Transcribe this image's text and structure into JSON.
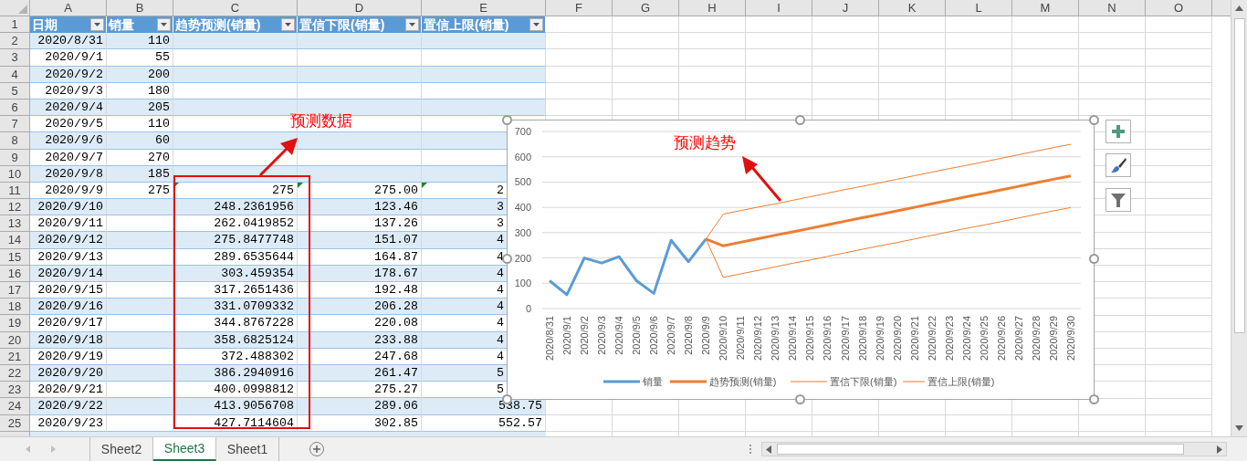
{
  "columns": [
    "A",
    "B",
    "C",
    "D",
    "E",
    "F",
    "G",
    "H",
    "I",
    "J",
    "K",
    "L",
    "M",
    "N",
    "O"
  ],
  "table": {
    "header": {
      "row_number": "1",
      "cells": [
        "日期",
        "销量",
        "趋势预测(销量)",
        "置信下限(销量)",
        "置信上限(销量)"
      ]
    },
    "rows": [
      {
        "row_number": "2",
        "date": "2020/8/31",
        "sales": "110"
      },
      {
        "row_number": "3",
        "date": "2020/9/1",
        "sales": "55"
      },
      {
        "row_number": "4",
        "date": "2020/9/2",
        "sales": "200"
      },
      {
        "row_number": "5",
        "date": "2020/9/3",
        "sales": "180"
      },
      {
        "row_number": "6",
        "date": "2020/9/4",
        "sales": "205"
      },
      {
        "row_number": "7",
        "date": "2020/9/5",
        "sales": "110"
      },
      {
        "row_number": "8",
        "date": "2020/9/6",
        "sales": "60"
      },
      {
        "row_number": "9",
        "date": "2020/9/7",
        "sales": "270"
      },
      {
        "row_number": "10",
        "date": "2020/9/8",
        "sales": "185"
      },
      {
        "row_number": "11",
        "date": "2020/9/9",
        "sales": "275",
        "trend": "275",
        "lower": "275.00",
        "upper": "2",
        "upper_cut": true,
        "flagged": true
      },
      {
        "row_number": "12",
        "date": "2020/9/10",
        "trend": "248.2361956",
        "lower": "123.46",
        "upper": "3",
        "upper_cut": true
      },
      {
        "row_number": "13",
        "date": "2020/9/11",
        "trend": "262.0419852",
        "lower": "137.26",
        "upper": "3",
        "upper_cut": true
      },
      {
        "row_number": "14",
        "date": "2020/9/12",
        "trend": "275.8477748",
        "lower": "151.07",
        "upper": "4",
        "upper_cut": true
      },
      {
        "row_number": "15",
        "date": "2020/9/13",
        "trend": "289.6535644",
        "lower": "164.87",
        "upper": "4",
        "upper_cut": true
      },
      {
        "row_number": "16",
        "date": "2020/9/14",
        "trend": "303.459354",
        "lower": "178.67",
        "upper": "4",
        "upper_cut": true
      },
      {
        "row_number": "17",
        "date": "2020/9/15",
        "trend": "317.2651436",
        "lower": "192.48",
        "upper": "4",
        "upper_cut": true
      },
      {
        "row_number": "18",
        "date": "2020/9/16",
        "trend": "331.0709332",
        "lower": "206.28",
        "upper": "4",
        "upper_cut": true
      },
      {
        "row_number": "19",
        "date": "2020/9/17",
        "trend": "344.8767228",
        "lower": "220.08",
        "upper": "4",
        "upper_cut": true
      },
      {
        "row_number": "20",
        "date": "2020/9/18",
        "trend": "358.6825124",
        "lower": "233.88",
        "upper": "4",
        "upper_cut": true
      },
      {
        "row_number": "21",
        "date": "2020/9/19",
        "trend": "372.488302",
        "lower": "247.68",
        "upper": "4",
        "upper_cut": true
      },
      {
        "row_number": "22",
        "date": "2020/9/20",
        "trend": "386.2940916",
        "lower": "261.47",
        "upper": "5",
        "upper_cut": true
      },
      {
        "row_number": "23",
        "date": "2020/9/21",
        "trend": "400.0998812",
        "lower": "275.27",
        "upper": "5",
        "upper_cut": true
      },
      {
        "row_number": "24",
        "date": "2020/9/22",
        "trend": "413.9056708",
        "lower": "289.06",
        "upper": "538.75",
        "upper_cut": false
      },
      {
        "row_number": "25",
        "date": "2020/9/23",
        "trend": "427.7114604",
        "lower": "302.85",
        "upper": "552.57",
        "upper_cut": false
      }
    ]
  },
  "callouts": [
    {
      "text": "预测数据"
    },
    {
      "text": "预测趋势"
    }
  ],
  "chart": {
    "chart_data": {
      "type": "line",
      "categories": [
        "2020/8/31",
        "2020/9/1",
        "2020/9/2",
        "2020/9/3",
        "2020/9/4",
        "2020/9/5",
        "2020/9/6",
        "2020/9/7",
        "2020/9/8",
        "2020/9/9",
        "2020/9/10",
        "2020/9/11",
        "2020/9/12",
        "2020/9/13",
        "2020/9/14",
        "2020/9/15",
        "2020/9/16",
        "2020/9/17",
        "2020/9/18",
        "2020/9/19",
        "2020/9/20",
        "2020/9/21",
        "2020/9/22",
        "2020/9/23",
        "2020/9/24",
        "2020/9/25",
        "2020/9/26",
        "2020/9/27",
        "2020/9/28",
        "2020/9/29",
        "2020/9/30"
      ],
      "series": [
        {
          "name": "销量",
          "color": "#5b9bd5",
          "values": [
            110,
            55,
            200,
            180,
            205,
            110,
            60,
            270,
            185,
            275,
            null,
            null,
            null,
            null,
            null,
            null,
            null,
            null,
            null,
            null,
            null,
            null,
            null,
            null,
            null,
            null,
            null,
            null,
            null,
            null,
            null
          ]
        },
        {
          "name": "趋势预测(销量)",
          "color": "#ed7d31",
          "values": [
            null,
            null,
            null,
            null,
            null,
            null,
            null,
            null,
            null,
            275,
            248,
            262,
            276,
            290,
            303,
            317,
            331,
            345,
            359,
            372,
            386,
            400,
            414,
            428,
            442,
            455,
            469,
            483,
            497,
            511,
            524
          ]
        },
        {
          "name": "置信下限(销量)",
          "color": "#ed7d31",
          "values": [
            null,
            null,
            null,
            null,
            null,
            null,
            null,
            null,
            null,
            275,
            123,
            137,
            151,
            165,
            179,
            192,
            206,
            220,
            234,
            248,
            261,
            275,
            289,
            303,
            317,
            330,
            344,
            358,
            372,
            386,
            399
          ]
        },
        {
          "name": "置信上限(销量)",
          "color": "#ed7d31",
          "values": [
            null,
            null,
            null,
            null,
            null,
            null,
            null,
            null,
            null,
            275,
            373,
            387,
            401,
            414,
            428,
            442,
            456,
            470,
            483,
            497,
            511,
            525,
            539,
            553,
            566,
            580,
            594,
            608,
            622,
            636,
            649
          ]
        }
      ],
      "ylim": [
        0,
        700
      ],
      "yticks": [
        0,
        100,
        200,
        300,
        400,
        500,
        600,
        700
      ],
      "grid": true,
      "legend": true
    }
  },
  "sheets": [
    {
      "label": "Sheet2",
      "selected": false
    },
    {
      "label": "Sheet3",
      "selected": true
    },
    {
      "label": "Sheet1",
      "selected": false
    }
  ]
}
